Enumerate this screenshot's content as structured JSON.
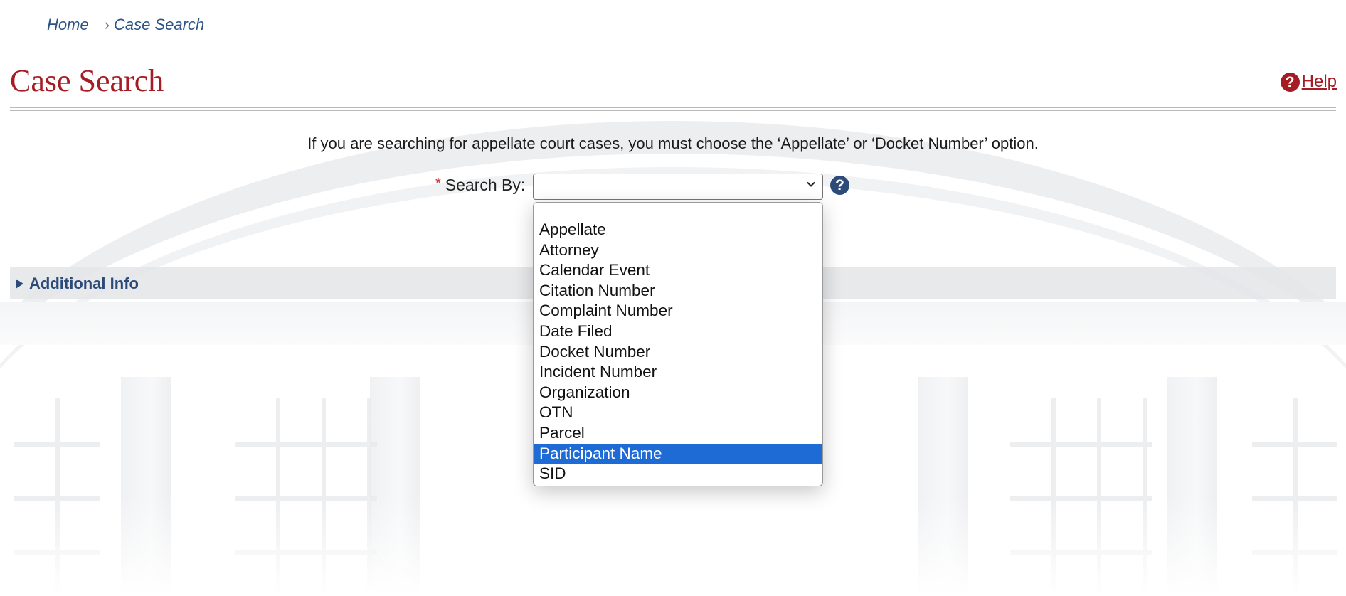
{
  "breadcrumb": {
    "home": "Home",
    "separator": "›",
    "current": "Case Search"
  },
  "header": {
    "title": "Case Search",
    "help_label": "Help",
    "help_icon": "?"
  },
  "form": {
    "info_text": "If you are searching for appellate court cases, you must choose the ‘Appellate’ or ‘Docket Number’ option.",
    "required_marker": "*",
    "search_by_label": "Search By:",
    "search_by_value": "",
    "field_help_icon": "?"
  },
  "additional_info": {
    "label": "Additional Info"
  },
  "dropdown": {
    "options": [
      "",
      "Appellate",
      "Attorney",
      "Calendar Event",
      "Citation Number",
      "Complaint Number",
      "Date Filed",
      "Docket Number",
      "Incident Number",
      "Organization",
      "OTN",
      "Parcel",
      "Participant Name",
      "SID"
    ],
    "highlighted": "Participant Name"
  },
  "colors": {
    "title_red": "#a51c24",
    "link_blue": "#2d5486",
    "navy": "#2d4b78",
    "highlight_blue": "#1f6bd6"
  }
}
